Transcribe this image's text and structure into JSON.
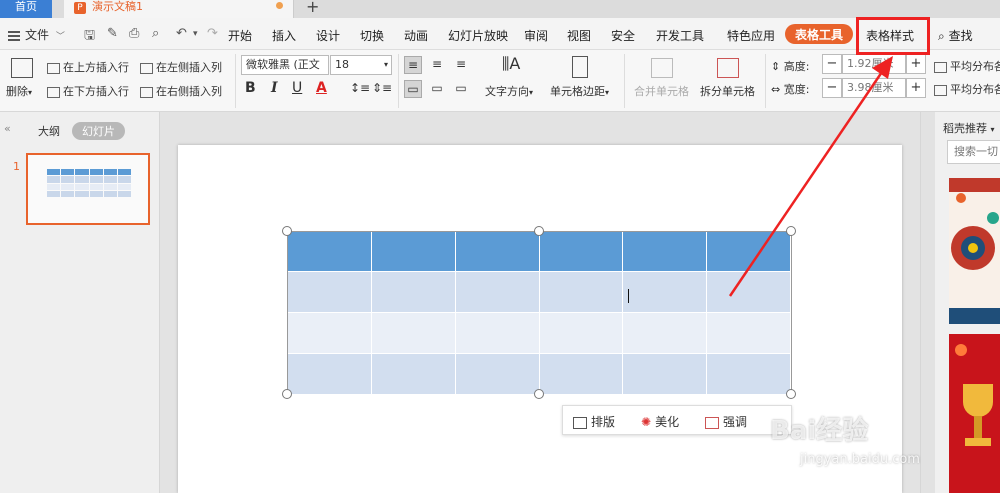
{
  "titlebar": {
    "home": "首页",
    "doc_name": "演示文稿1",
    "add": "+"
  },
  "menu": {
    "file": "文件",
    "items": [
      "开始",
      "插入",
      "设计",
      "切换",
      "动画",
      "幻灯片放映",
      "审阅",
      "视图",
      "安全",
      "开发工具",
      "特色应用"
    ],
    "table_tools": "表格工具",
    "table_style": "表格样式",
    "search": "查找"
  },
  "ribbon": {
    "delete": "删除",
    "insert_above": "在上方插入行",
    "insert_below": "在下方插入行",
    "insert_left": "在左侧插入列",
    "insert_right": "在右侧插入列",
    "font_name": "微软雅黑 (正文",
    "font_size": "18",
    "bold": "B",
    "italic": "I",
    "underline": "U",
    "font_color": "A",
    "text_direction": "文字方向",
    "cell_margin": "单元格边距",
    "merge_cells": "合并单元格",
    "split_cells": "拆分单元格",
    "height_label": "高度:",
    "height_value": "1.92厘米",
    "width_label": "宽度:",
    "width_value": "3.98厘米",
    "distribute_rows": "平均分布各",
    "distribute_cols": "平均分布各",
    "minus": "−",
    "plus": "+"
  },
  "leftpanel": {
    "outline": "大纲",
    "slides": "幻灯片",
    "slide_number": "1"
  },
  "quickbar": {
    "layout": "排版",
    "beautify": "美化",
    "emphasize": "强调"
  },
  "rightpanel": {
    "title": "稻壳推荐",
    "search_placeholder": "搜索一切"
  },
  "watermark": {
    "brand": "Bai经验",
    "url": "jingyan.baidu.com"
  },
  "colors": {
    "accent": "#e8632c",
    "table_header": "#5b9bd5",
    "table_band": "#d2deef",
    "annotation": "#ee2222"
  }
}
